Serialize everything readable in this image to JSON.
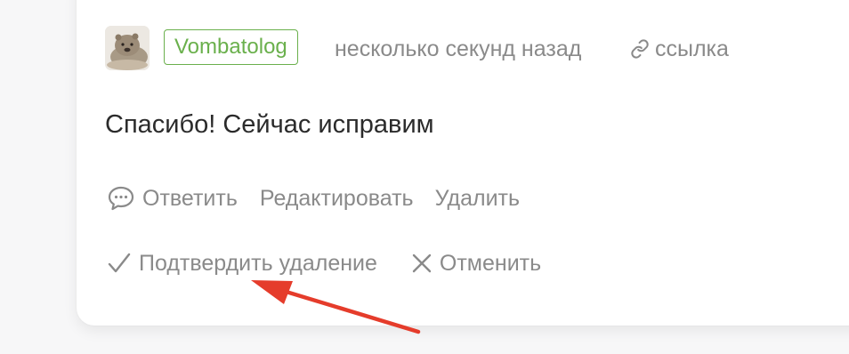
{
  "comment": {
    "author": "Vombatolog",
    "timestamp": "несколько секунд назад",
    "link_label": "ссылка",
    "text": "Спасибо! Сейчас исправим"
  },
  "actions": {
    "reply_label": "Ответить",
    "edit_label": "Редактировать",
    "delete_label": "Удалить"
  },
  "confirmation": {
    "confirm_label": "Подтвердить удаление",
    "cancel_label": "Отменить"
  },
  "icons": {
    "link": "link-icon",
    "reply": "speech-bubble-icon",
    "confirm": "checkmark-icon",
    "cancel": "close-icon"
  },
  "colors": {
    "author_badge": "#6ab04c",
    "muted_text": "#8a8a8a",
    "annotation_arrow": "#e53c2b"
  }
}
